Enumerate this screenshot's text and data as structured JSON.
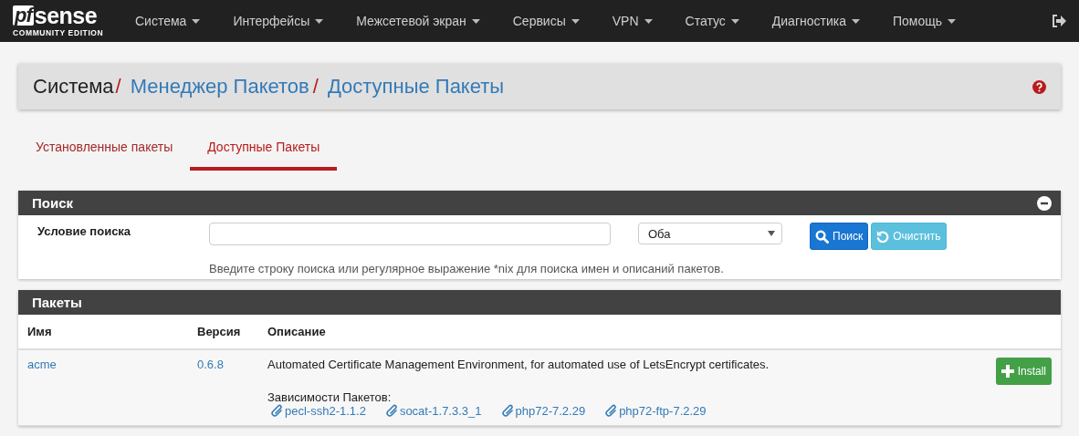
{
  "logo": {
    "prefix": "pf",
    "name": "sense",
    "edition": "COMMUNITY EDITION"
  },
  "menu": [
    {
      "label": "Система"
    },
    {
      "label": "Интерфейсы"
    },
    {
      "label": "Межсетевой экран"
    },
    {
      "label": "Сервисы"
    },
    {
      "label": "VPN"
    },
    {
      "label": "Статус"
    },
    {
      "label": "Диагностика"
    },
    {
      "label": "Помощь"
    }
  ],
  "breadcrumb": [
    {
      "label": "Система",
      "kind": "text"
    },
    {
      "label": "/",
      "kind": "separator"
    },
    {
      "label": "Менеджер Пакетов",
      "kind": "link"
    },
    {
      "label": "/",
      "kind": "separator"
    },
    {
      "label": "Доступные Пакеты",
      "kind": "link"
    }
  ],
  "tabs": [
    {
      "label": "Установленные пакеты",
      "selected": false
    },
    {
      "label": "Доступные Пакеты",
      "selected": true
    }
  ],
  "search_panel": {
    "title": "Поиск",
    "label": "Условие поиска",
    "scope": {
      "value": "Оба"
    },
    "buttons": [
      {
        "label": "Поиск",
        "kind": "primary"
      },
      {
        "label": "Очистить",
        "kind": "info"
      }
    ],
    "hint": "Введите строку поиска или регулярное выражение *nix для поиска имен и описаний пакетов."
  },
  "packages_panel": {
    "title": "Пакеты",
    "columns": [
      "Имя",
      "Версия",
      "Описание"
    ],
    "rows": [
      {
        "name": "acme",
        "version": "0.6.8",
        "description": "Automated Certificate Management Environment, for automated use of LetsEncrypt certificates.",
        "deps_label": "Зависимости Пакетов:",
        "deps": [
          "pecl-ssh2-1.1.2",
          "socat-1.7.3.3_1",
          "php72-7.2.29",
          "php72-ftp-7.2.29"
        ],
        "action": "Install"
      }
    ]
  }
}
